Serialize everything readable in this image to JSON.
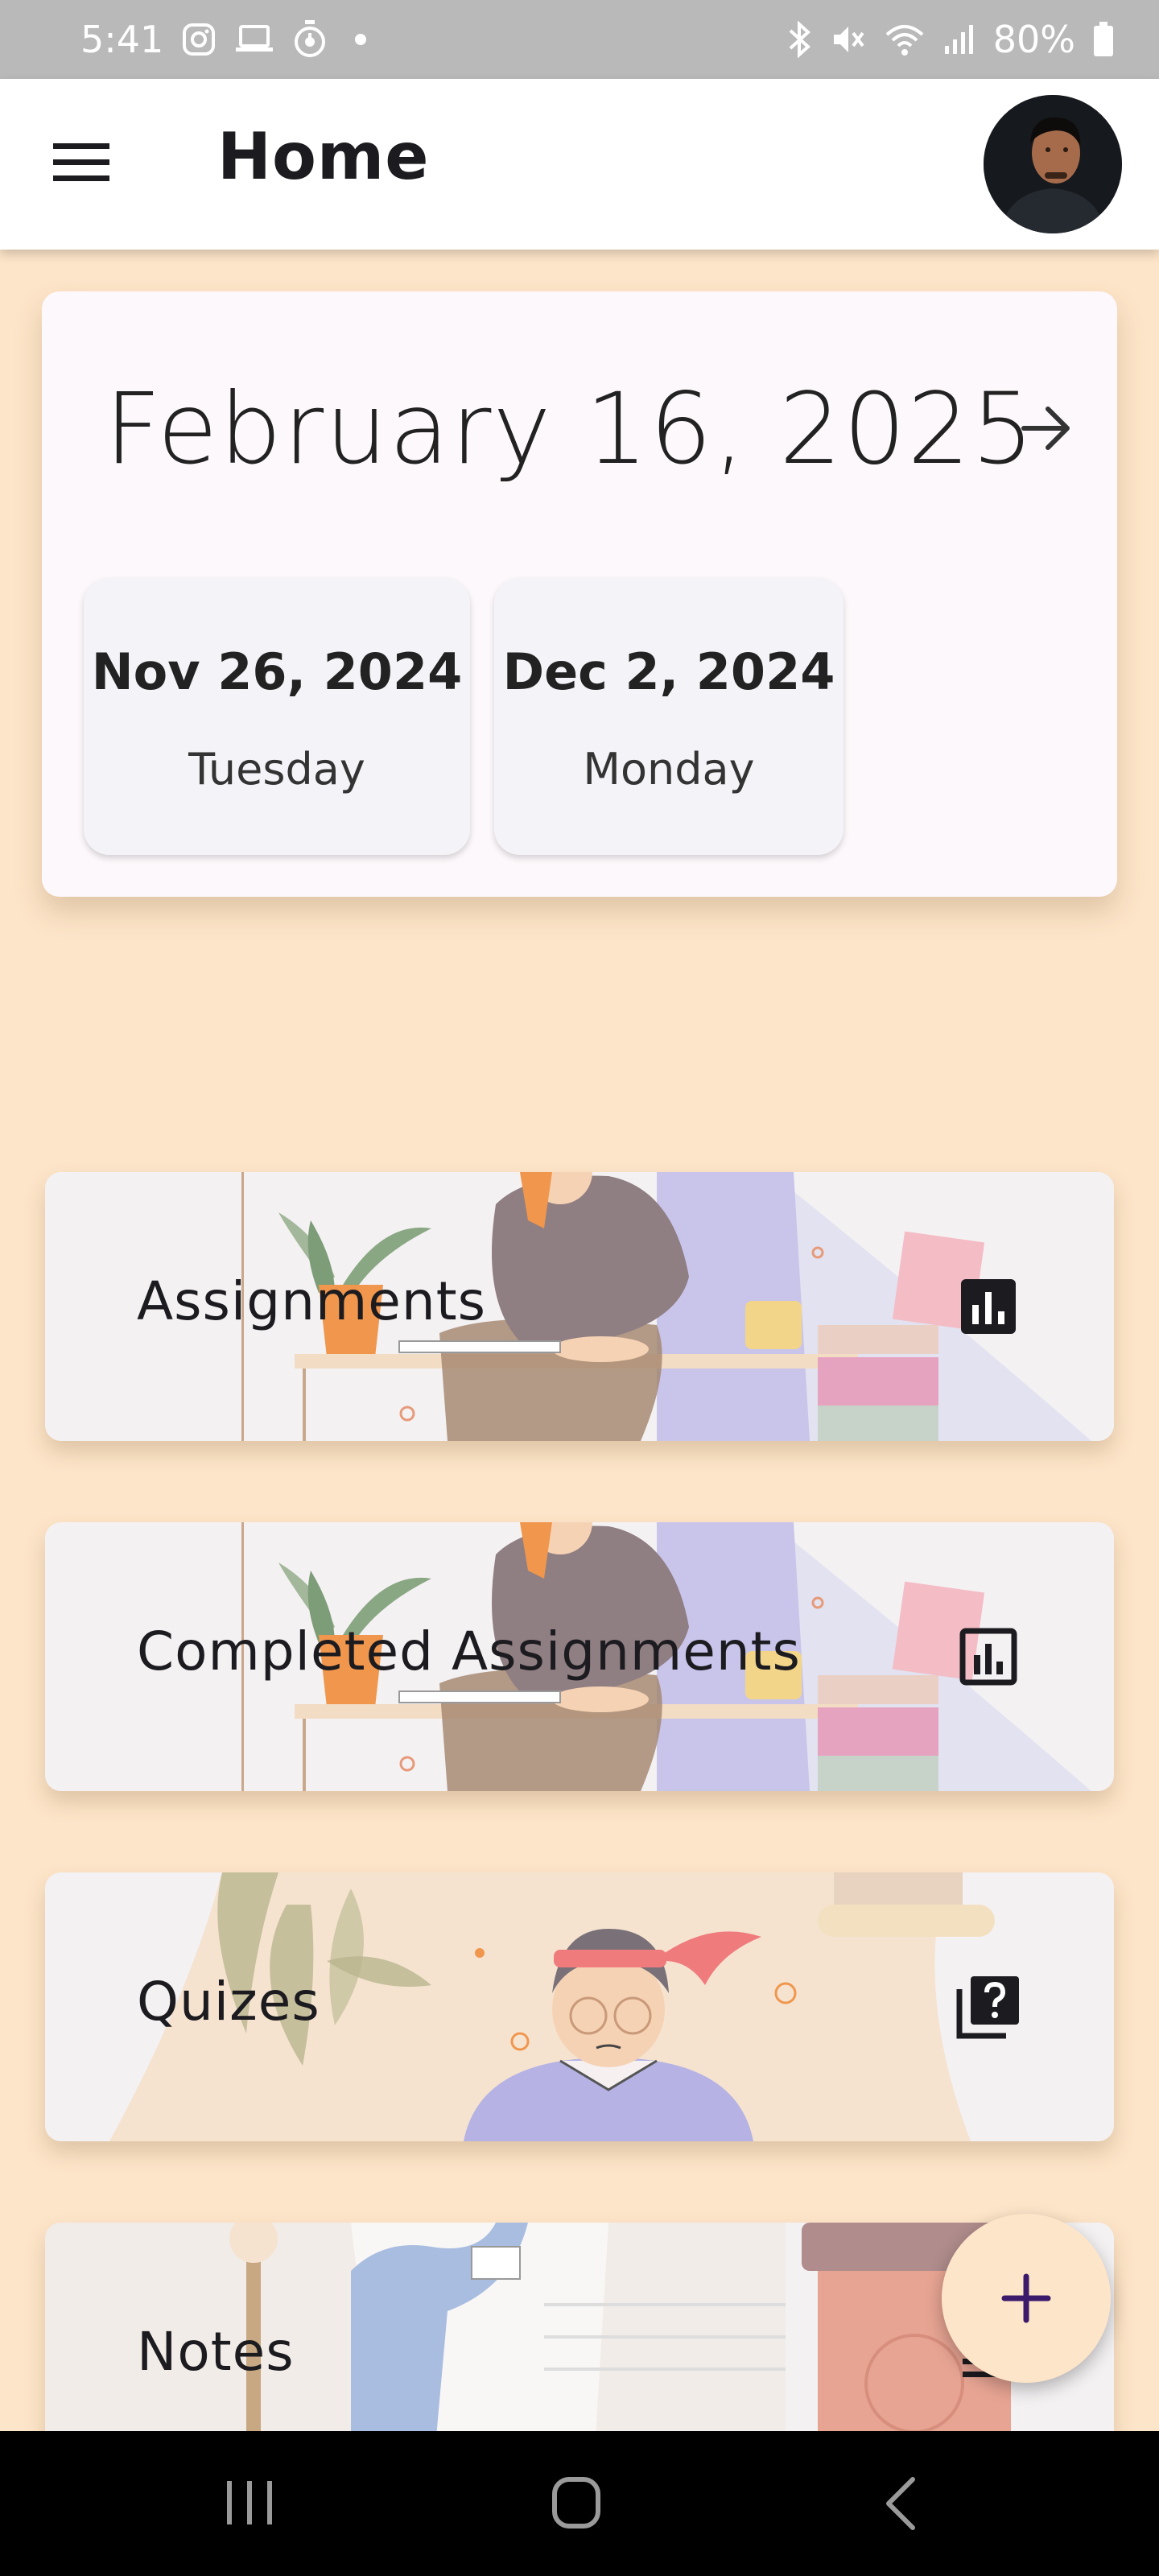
{
  "status_bar": {
    "time": "5:41",
    "battery": "80%",
    "left_icons": [
      "instagram-icon",
      "laptop-icon",
      "timer-icon",
      "dot-icon"
    ],
    "right_icons": [
      "bluetooth-icon",
      "mute-icon",
      "wifi-icon",
      "signal-icon",
      "battery-icon"
    ]
  },
  "app_bar": {
    "title": "Home",
    "menu_icon": "hamburger-menu-icon",
    "avatar_icon": "user-avatar"
  },
  "calendar": {
    "current_date": "February 16, 2025",
    "next_icon": "arrow-right-icon",
    "dates": [
      {
        "date": "Nov 26, 2024",
        "day": "Tuesday"
      },
      {
        "date": "Dec 2, 2024",
        "day": "Monday"
      }
    ]
  },
  "categories": [
    {
      "label": "Assignments",
      "icon": "bar-chart-icon"
    },
    {
      "label": "Completed Assignments",
      "icon": "bar-chart-outline-icon"
    },
    {
      "label": "Quizes",
      "icon": "quiz-icon"
    },
    {
      "label": "Notes",
      "icon": "notes-icon"
    }
  ],
  "fab": {
    "icon": "plus-icon"
  },
  "nav_bar": {
    "icons": [
      "recent-apps-icon",
      "home-icon",
      "back-icon"
    ]
  },
  "colors": {
    "background": "#fde5c9",
    "card": "#fdf8fb",
    "chip": "#f4f3f8",
    "fab_icon": "#3b1a6b",
    "status_bar": "#b9b9b9"
  }
}
